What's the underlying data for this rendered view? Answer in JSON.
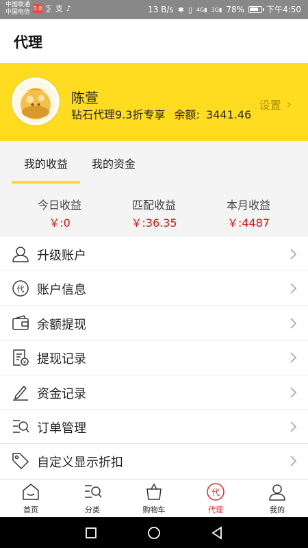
{
  "status_bar": {
    "carrier_1": "中国联通",
    "carrier_2": "中国电信",
    "badge": "3.8",
    "network_speed": "13 B/s",
    "network_4g": "4G",
    "network_3g": "3G",
    "battery": "78%",
    "time": "下午4:50"
  },
  "header": {
    "title": "代理"
  },
  "profile": {
    "name": "陈萱",
    "level": "钻石代理9.3折专享",
    "balance_label": "余额:",
    "balance_value": "3441.46",
    "settings_label": "设置",
    "settings_icon": "chevron-right-icon"
  },
  "tabs": [
    {
      "label": "我的收益",
      "active": true
    },
    {
      "label": "我的资金",
      "active": false
    }
  ],
  "earnings": [
    {
      "label": "今日收益",
      "value": "￥:0"
    },
    {
      "label": "匹配收益",
      "value": "￥:36.35"
    },
    {
      "label": "本月收益",
      "value": "￥:4487"
    }
  ],
  "menu": [
    {
      "label": "升级账户",
      "icon": "user-icon"
    },
    {
      "label": "账户信息",
      "icon": "agent-badge-icon"
    },
    {
      "label": "余额提现",
      "icon": "wallet-icon"
    },
    {
      "label": "提现记录",
      "icon": "receipt-icon"
    },
    {
      "label": "资金记录",
      "icon": "pencil-icon"
    },
    {
      "label": "订单管理",
      "icon": "order-list-icon"
    },
    {
      "label": "自定义显示折扣",
      "icon": "tag-icon"
    }
  ],
  "bottom_nav": [
    {
      "label": "首页",
      "icon": "home-icon"
    },
    {
      "label": "分类",
      "icon": "category-search-icon"
    },
    {
      "label": "购物车",
      "icon": "cart-icon"
    },
    {
      "label": "代理",
      "icon": "agent-icon",
      "active": true
    },
    {
      "label": "我的",
      "icon": "profile-icon"
    }
  ],
  "colors": {
    "accent_yellow": "#ffdc1f",
    "price_red": "#e01010",
    "active_nav": "#e23030"
  }
}
